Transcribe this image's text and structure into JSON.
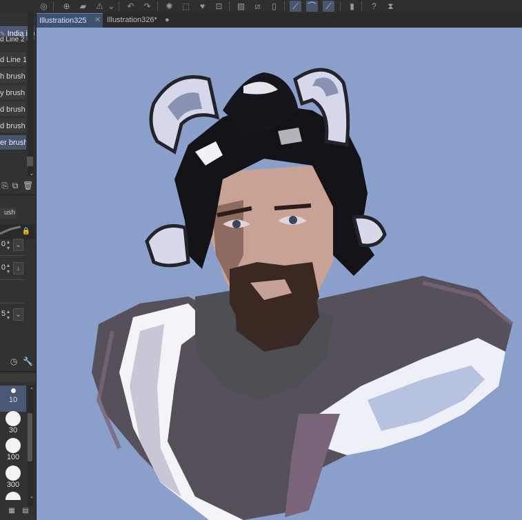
{
  "toolbar": {
    "icons": [
      "spiral-icon",
      "new-icon",
      "open-icon",
      "warning-icon",
      "undo-icon",
      "redo-icon",
      "burst-icon",
      "selection-icon",
      "fill-icon",
      "transform-icon",
      "grid-icon",
      "crop-icon",
      "page-icon",
      "ruler-icon",
      "curve-icon",
      "stroke-icon",
      "phone-icon",
      "help-icon",
      "flip-icon"
    ]
  },
  "subtools": {
    "items": [
      "India ink",
      "d Line 2",
      "d Line 1",
      "h brush",
      "y brush",
      "d brush",
      "d brush",
      "er brush"
    ]
  },
  "property": {
    "tab_label": "ush",
    "rows": [
      {
        "value": "0"
      },
      {
        "value": "0"
      },
      {
        "value": "5"
      }
    ]
  },
  "brush_sizes": {
    "items": [
      {
        "label": "10"
      },
      {
        "label": "30"
      },
      {
        "label": "100"
      },
      {
        "label": "300"
      }
    ]
  },
  "tabs": [
    {
      "label": "Illustration325",
      "close": "✕"
    },
    {
      "label": "Illustration326*",
      "close": "●"
    }
  ],
  "colors": {
    "canvas_bg": "#8a9fc9",
    "accent": "#4c5a78"
  }
}
